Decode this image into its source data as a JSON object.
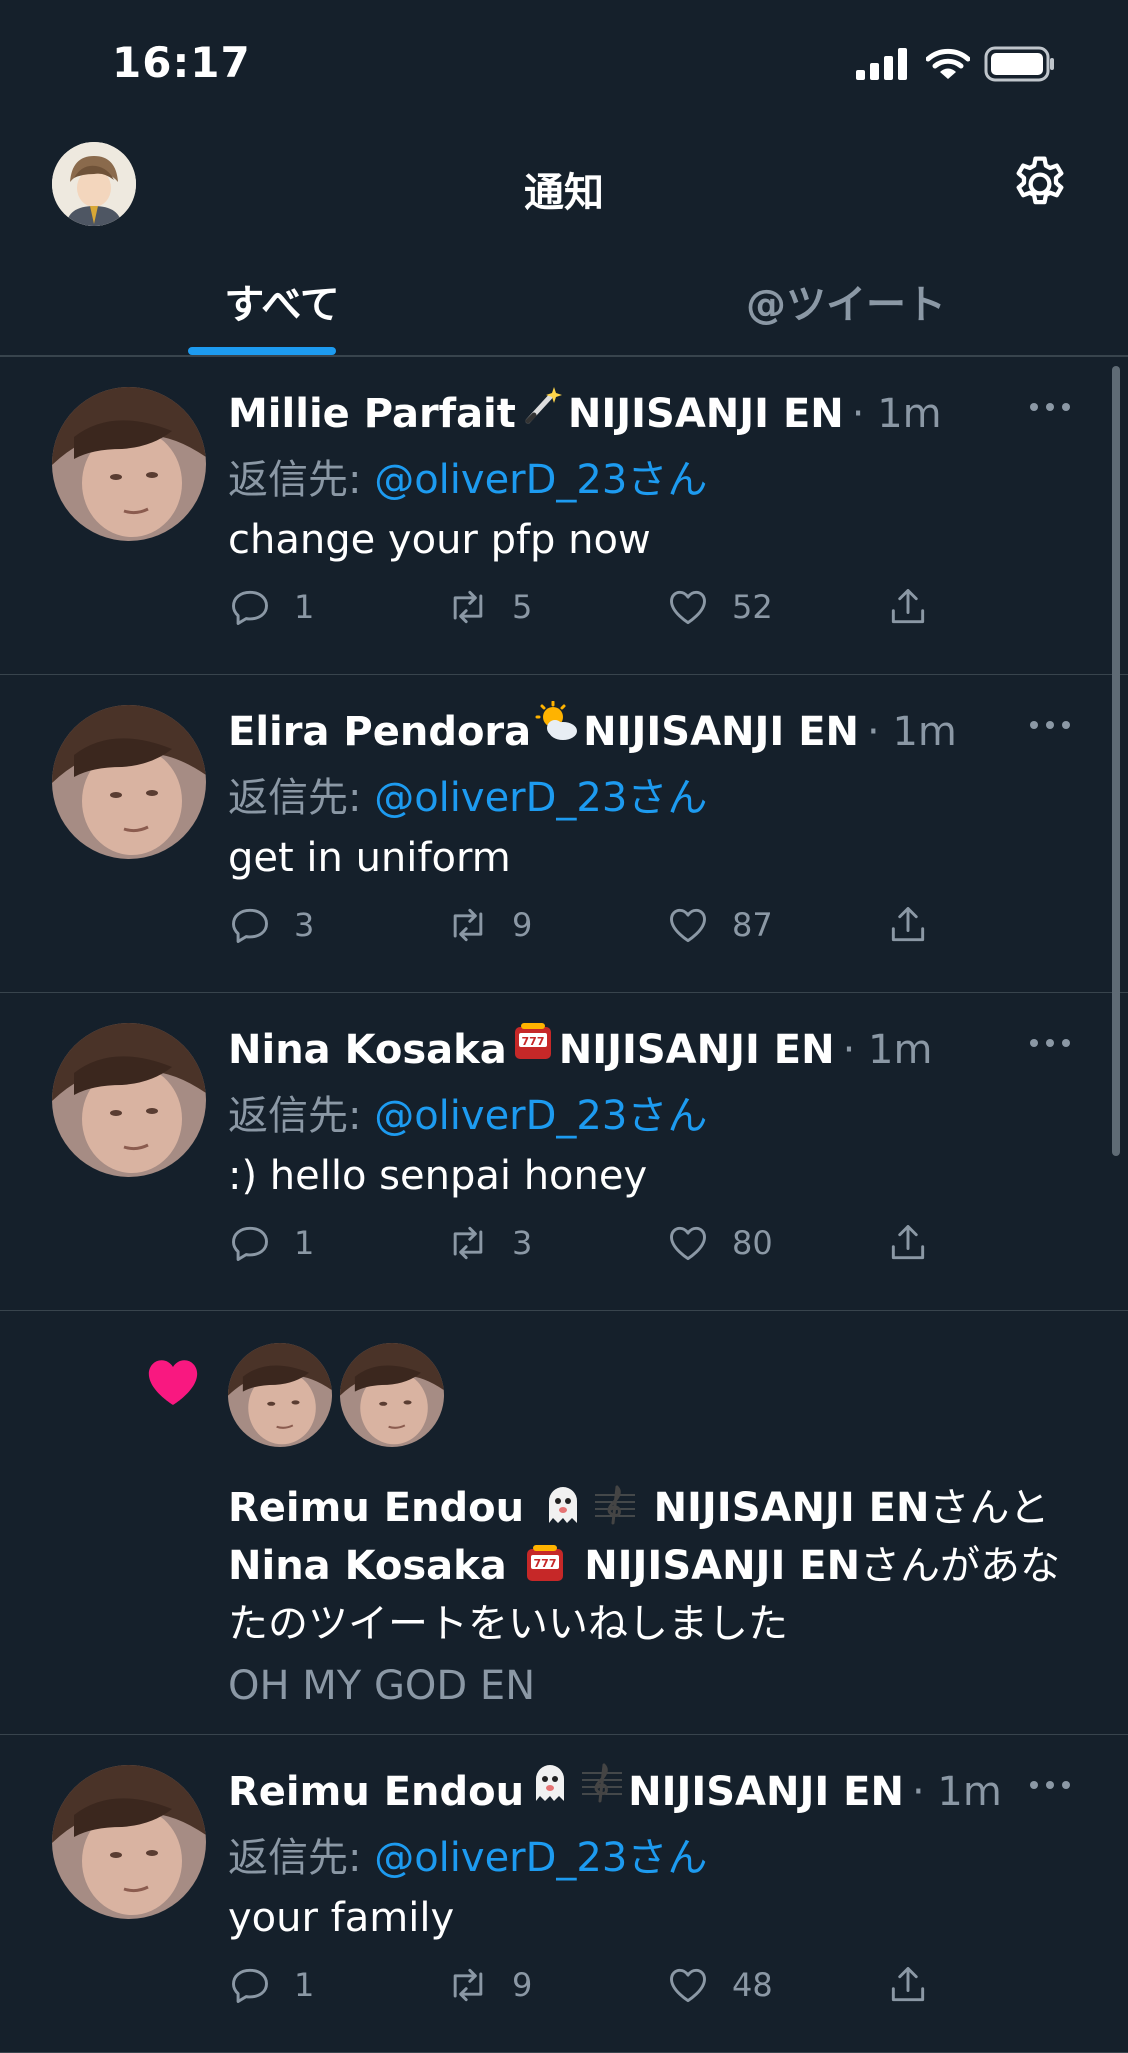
{
  "status_bar": {
    "time": "16:17"
  },
  "header": {
    "title": "通知",
    "settings_icon": "gear-icon"
  },
  "tabs": [
    {
      "label": "すべて",
      "active": true
    },
    {
      "label": "@ツイート",
      "active": false
    }
  ],
  "notifications": [
    {
      "type": "reply",
      "author": "Millie Parfait",
      "emoji": "magic-wand",
      "org": "NIJISANJI EN",
      "time": "1m",
      "reply_prefix": "返信先: ",
      "reply_handle": "@oliverD_23さん",
      "text": "change your pfp now",
      "stats": {
        "replies": "1",
        "retweets": "5",
        "likes": "52"
      }
    },
    {
      "type": "reply",
      "author": "Elira Pendora",
      "emoji": "sun-behind-cloud",
      "org": "NIJISANJI EN",
      "time": "1m",
      "reply_prefix": "返信先: ",
      "reply_handle": "@oliverD_23さん",
      "text": "get in uniform",
      "stats": {
        "replies": "3",
        "retweets": "9",
        "likes": "87"
      }
    },
    {
      "type": "reply",
      "author": "Nina Kosaka",
      "emoji": "slot-machine",
      "org": "NIJISANJI EN",
      "time": "1m",
      "reply_prefix": "返信先: ",
      "reply_handle": "@oliverD_23さん",
      "text": ":) hello senpai honey",
      "stats": {
        "replies": "1",
        "retweets": "3",
        "likes": "80"
      }
    },
    {
      "type": "like",
      "user1": "Reimu Endou",
      "user1_org": "NIJISANJI EN",
      "user1_suffix": "さんと",
      "user2": "Nina Kosaka",
      "user2_org": "NIJISANJI EN",
      "user2_suffix": "さんがあなたのツイートをいいねしました",
      "snippet": "OH MY GOD EN"
    },
    {
      "type": "reply",
      "author": "Reimu Endou",
      "emoji": "ghost-and-clef",
      "org": "NIJISANJI EN",
      "time": "1m",
      "reply_prefix": "返信先: ",
      "reply_handle": "@oliverD_23さん",
      "text": "your family",
      "stats": {
        "replies": "1",
        "retweets": "9",
        "likes": "48"
      }
    }
  ],
  "colors": {
    "background": "#15202b",
    "accent": "#1d9bf0",
    "like": "#f91880",
    "muted": "#8b98a5"
  }
}
